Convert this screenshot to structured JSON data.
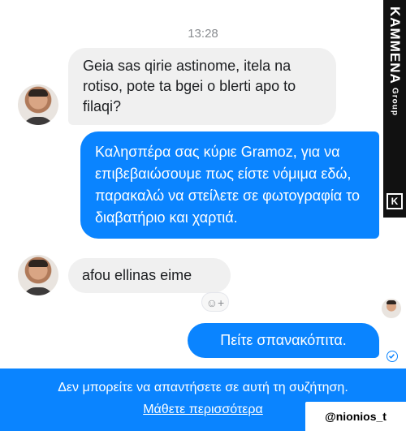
{
  "timestamp": "13:28",
  "messages": [
    {
      "direction": "in",
      "text": "Geia sas qirie astinome, itela na rotiso, pote ta bgei o blerti apo to filaqi?"
    },
    {
      "direction": "out",
      "text": "Καλησπέρα σας κύριε Gramoz, για να επιβεβαιώσουμε πως είστε νόμιμα εδώ, παρακαλώ να στείλετε σε φωτογραφία το διαβατήριο και χαρτιά."
    },
    {
      "direction": "in",
      "text": "afou ellinas eime"
    },
    {
      "direction": "out",
      "text": "Πείτε σπανακόπιτα."
    }
  ],
  "react_button": "☺+",
  "footer": {
    "message": "Δεν μπορείτε να απαντήσετε σε αυτή τη συζήτηση.",
    "link": "Μάθετε περισσότερα"
  },
  "handle": "@nionios_t",
  "watermark": {
    "brand": "KAMMENA",
    "group": "Group",
    "logo": "K"
  },
  "colors": {
    "accent": "#0a84ff",
    "incoming_bubble": "#f0f0f0",
    "background": "#ffffff"
  }
}
